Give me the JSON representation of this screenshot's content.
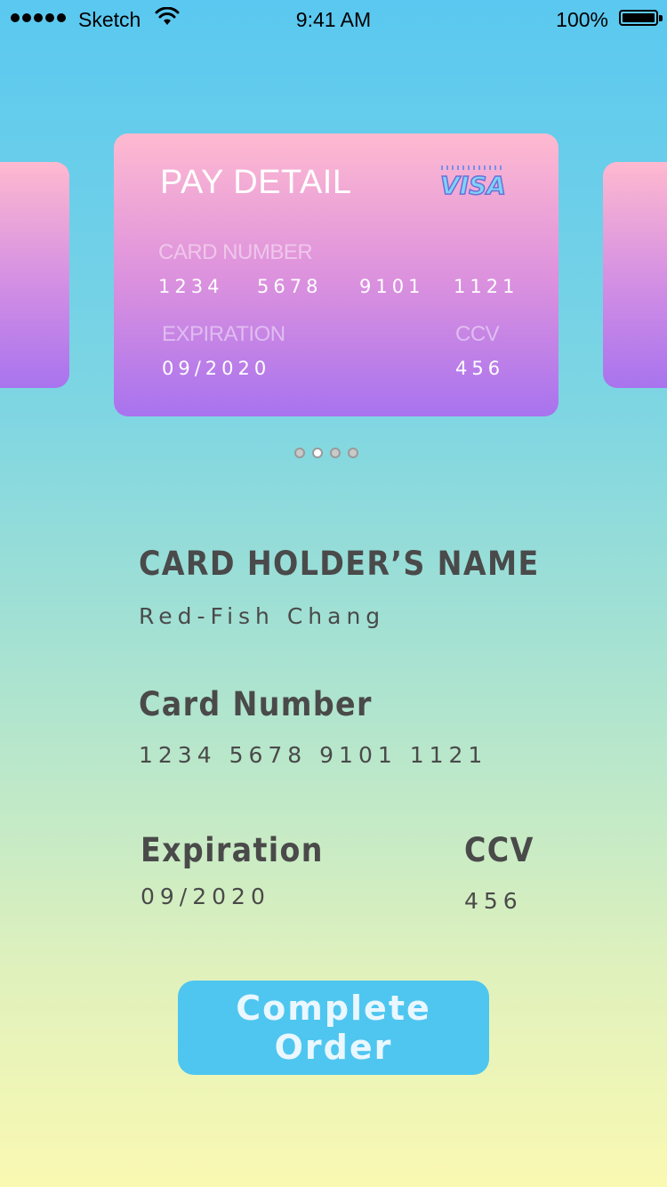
{
  "status_bar": {
    "carrier": "Sketch",
    "time": "9:41 AM",
    "battery_percent": "100%",
    "battery_level": 1.0,
    "signal_bars": 5,
    "icons": [
      "signal-dots-icon",
      "wifi-icon",
      "battery-icon"
    ]
  },
  "card": {
    "title": "PAY DETAIL",
    "brand": "VISA",
    "card_number_label": "CARD NUMBER",
    "card_number_groups": [
      "1234",
      "5678",
      "9101",
      "1121"
    ],
    "expiration_label": "EXPIRATION",
    "expiration_value": "09/2020",
    "ccv_label": "CCV",
    "ccv_value": "456",
    "gradient": [
      "#ffbad0",
      "#a873ef"
    ]
  },
  "pager": {
    "count": 4,
    "active_index": 1
  },
  "details": {
    "holder_heading": "CARD HOLDER’S NAME",
    "holder_value": "Red-Fish Chang",
    "number_heading": "Card Number",
    "number_value": "1234 5678 9101 1121",
    "expiration_heading": "Expiration",
    "expiration_value": "09/2020",
    "ccv_heading": "CCV",
    "ccv_value": "456"
  },
  "actions": {
    "complete_label": "Complete Order"
  },
  "colors": {
    "background_top": "#5ac8f0",
    "background_bottom": "#faf9b2",
    "button": "#4ec6f0",
    "text_dark": "#4a4a4a"
  }
}
